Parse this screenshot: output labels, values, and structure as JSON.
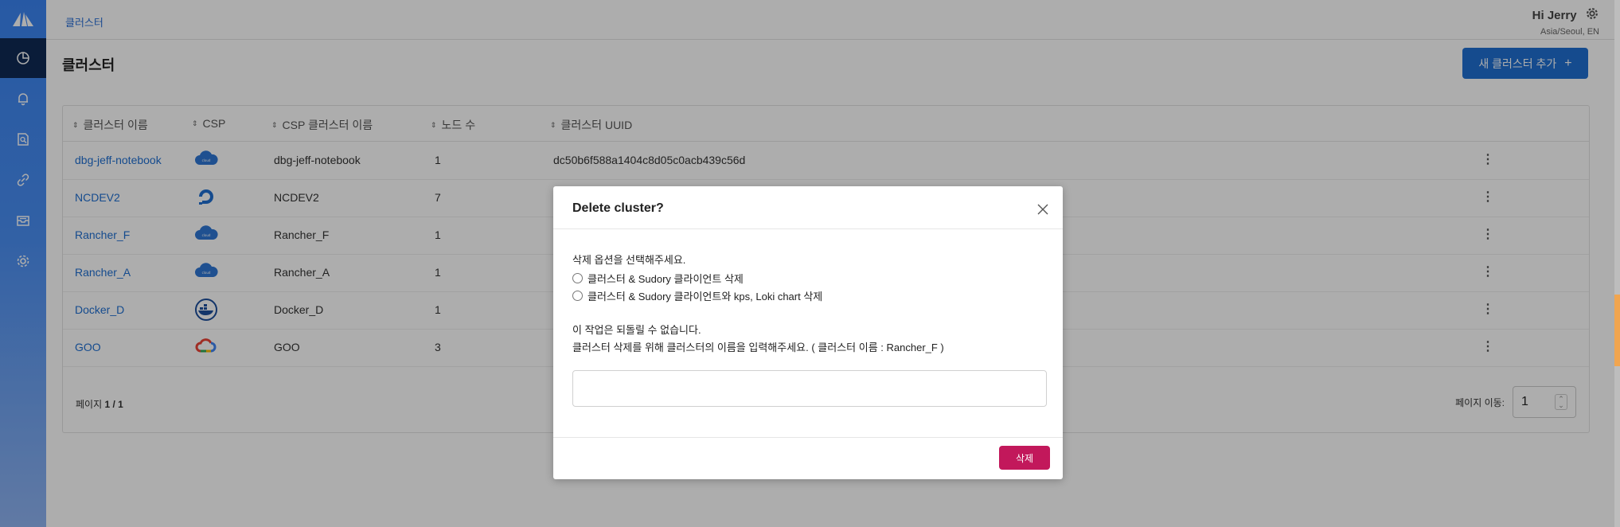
{
  "breadcrumb": "클러스터",
  "user": {
    "greeting": "Hi Jerry",
    "timezone": "Asia/Seoul, EN"
  },
  "page_title": "클러스터",
  "add_button": {
    "label": "새 클러스터 추가",
    "icon": "plus-icon"
  },
  "sidebar": {
    "items": [
      {
        "name": "dashboard",
        "icon": "pie-chart-icon",
        "active": true
      },
      {
        "name": "alerts",
        "icon": "bell-icon",
        "active": false
      },
      {
        "name": "reports",
        "icon": "document-search-icon",
        "active": false
      },
      {
        "name": "integrations",
        "icon": "link-icon",
        "active": false
      },
      {
        "name": "inbox",
        "icon": "inbox-icon",
        "active": false
      },
      {
        "name": "settings",
        "icon": "gear-icon",
        "active": false
      }
    ]
  },
  "table": {
    "columns": [
      "클러스터 이름",
      "CSP",
      "CSP 클러스터 이름",
      "노드 수",
      "클러스터 UUID"
    ],
    "rows": [
      {
        "name": "dbg-jeff-notebook",
        "csp": "cloud-icon",
        "csp_cluster": "dbg-jeff-notebook",
        "nodes": "1",
        "uuid": "dc50b6f588a1404c8d05c0acb439c56d"
      },
      {
        "name": "NCDEV2",
        "csp": "digitalocean-icon",
        "csp_cluster": "NCDEV2",
        "nodes": "7",
        "uuid": ""
      },
      {
        "name": "Rancher_F",
        "csp": "cloud-icon",
        "csp_cluster": "Rancher_F",
        "nodes": "1",
        "uuid": ""
      },
      {
        "name": "Rancher_A",
        "csp": "cloud-icon",
        "csp_cluster": "Rancher_A",
        "nodes": "1",
        "uuid": ""
      },
      {
        "name": "Docker_D",
        "csp": "docker-icon",
        "csp_cluster": "Docker_D",
        "nodes": "1",
        "uuid": ""
      },
      {
        "name": "GOO",
        "csp": "google-cloud-icon",
        "csp_cluster": "GOO",
        "nodes": "3",
        "uuid": ""
      }
    ]
  },
  "pagination": {
    "label": "페이지",
    "current": "1 / 1",
    "goto_label": "페이지 이동:",
    "goto_value": "1"
  },
  "modal": {
    "title": "Delete cluster?",
    "prompt": "삭제 옵션을 선택해주세요.",
    "options": [
      "클러스터 & Sudory 클라이언트 삭제",
      "클러스터 & Sudory 클라이언트와 kps, Loki chart 삭제"
    ],
    "warning": "이 작업은 되돌릴 수 없습니다.",
    "instruction": "클러스터 삭제를 위해 클러스터의 이름을 입력해주세요. ( 클러스터 이름 : Rancher_F )",
    "input_value": "",
    "delete_label": "삭제"
  },
  "colors": {
    "primary": "#1f6fd1",
    "danger": "#c2185b",
    "sidebar_active": "#0f2a55"
  }
}
